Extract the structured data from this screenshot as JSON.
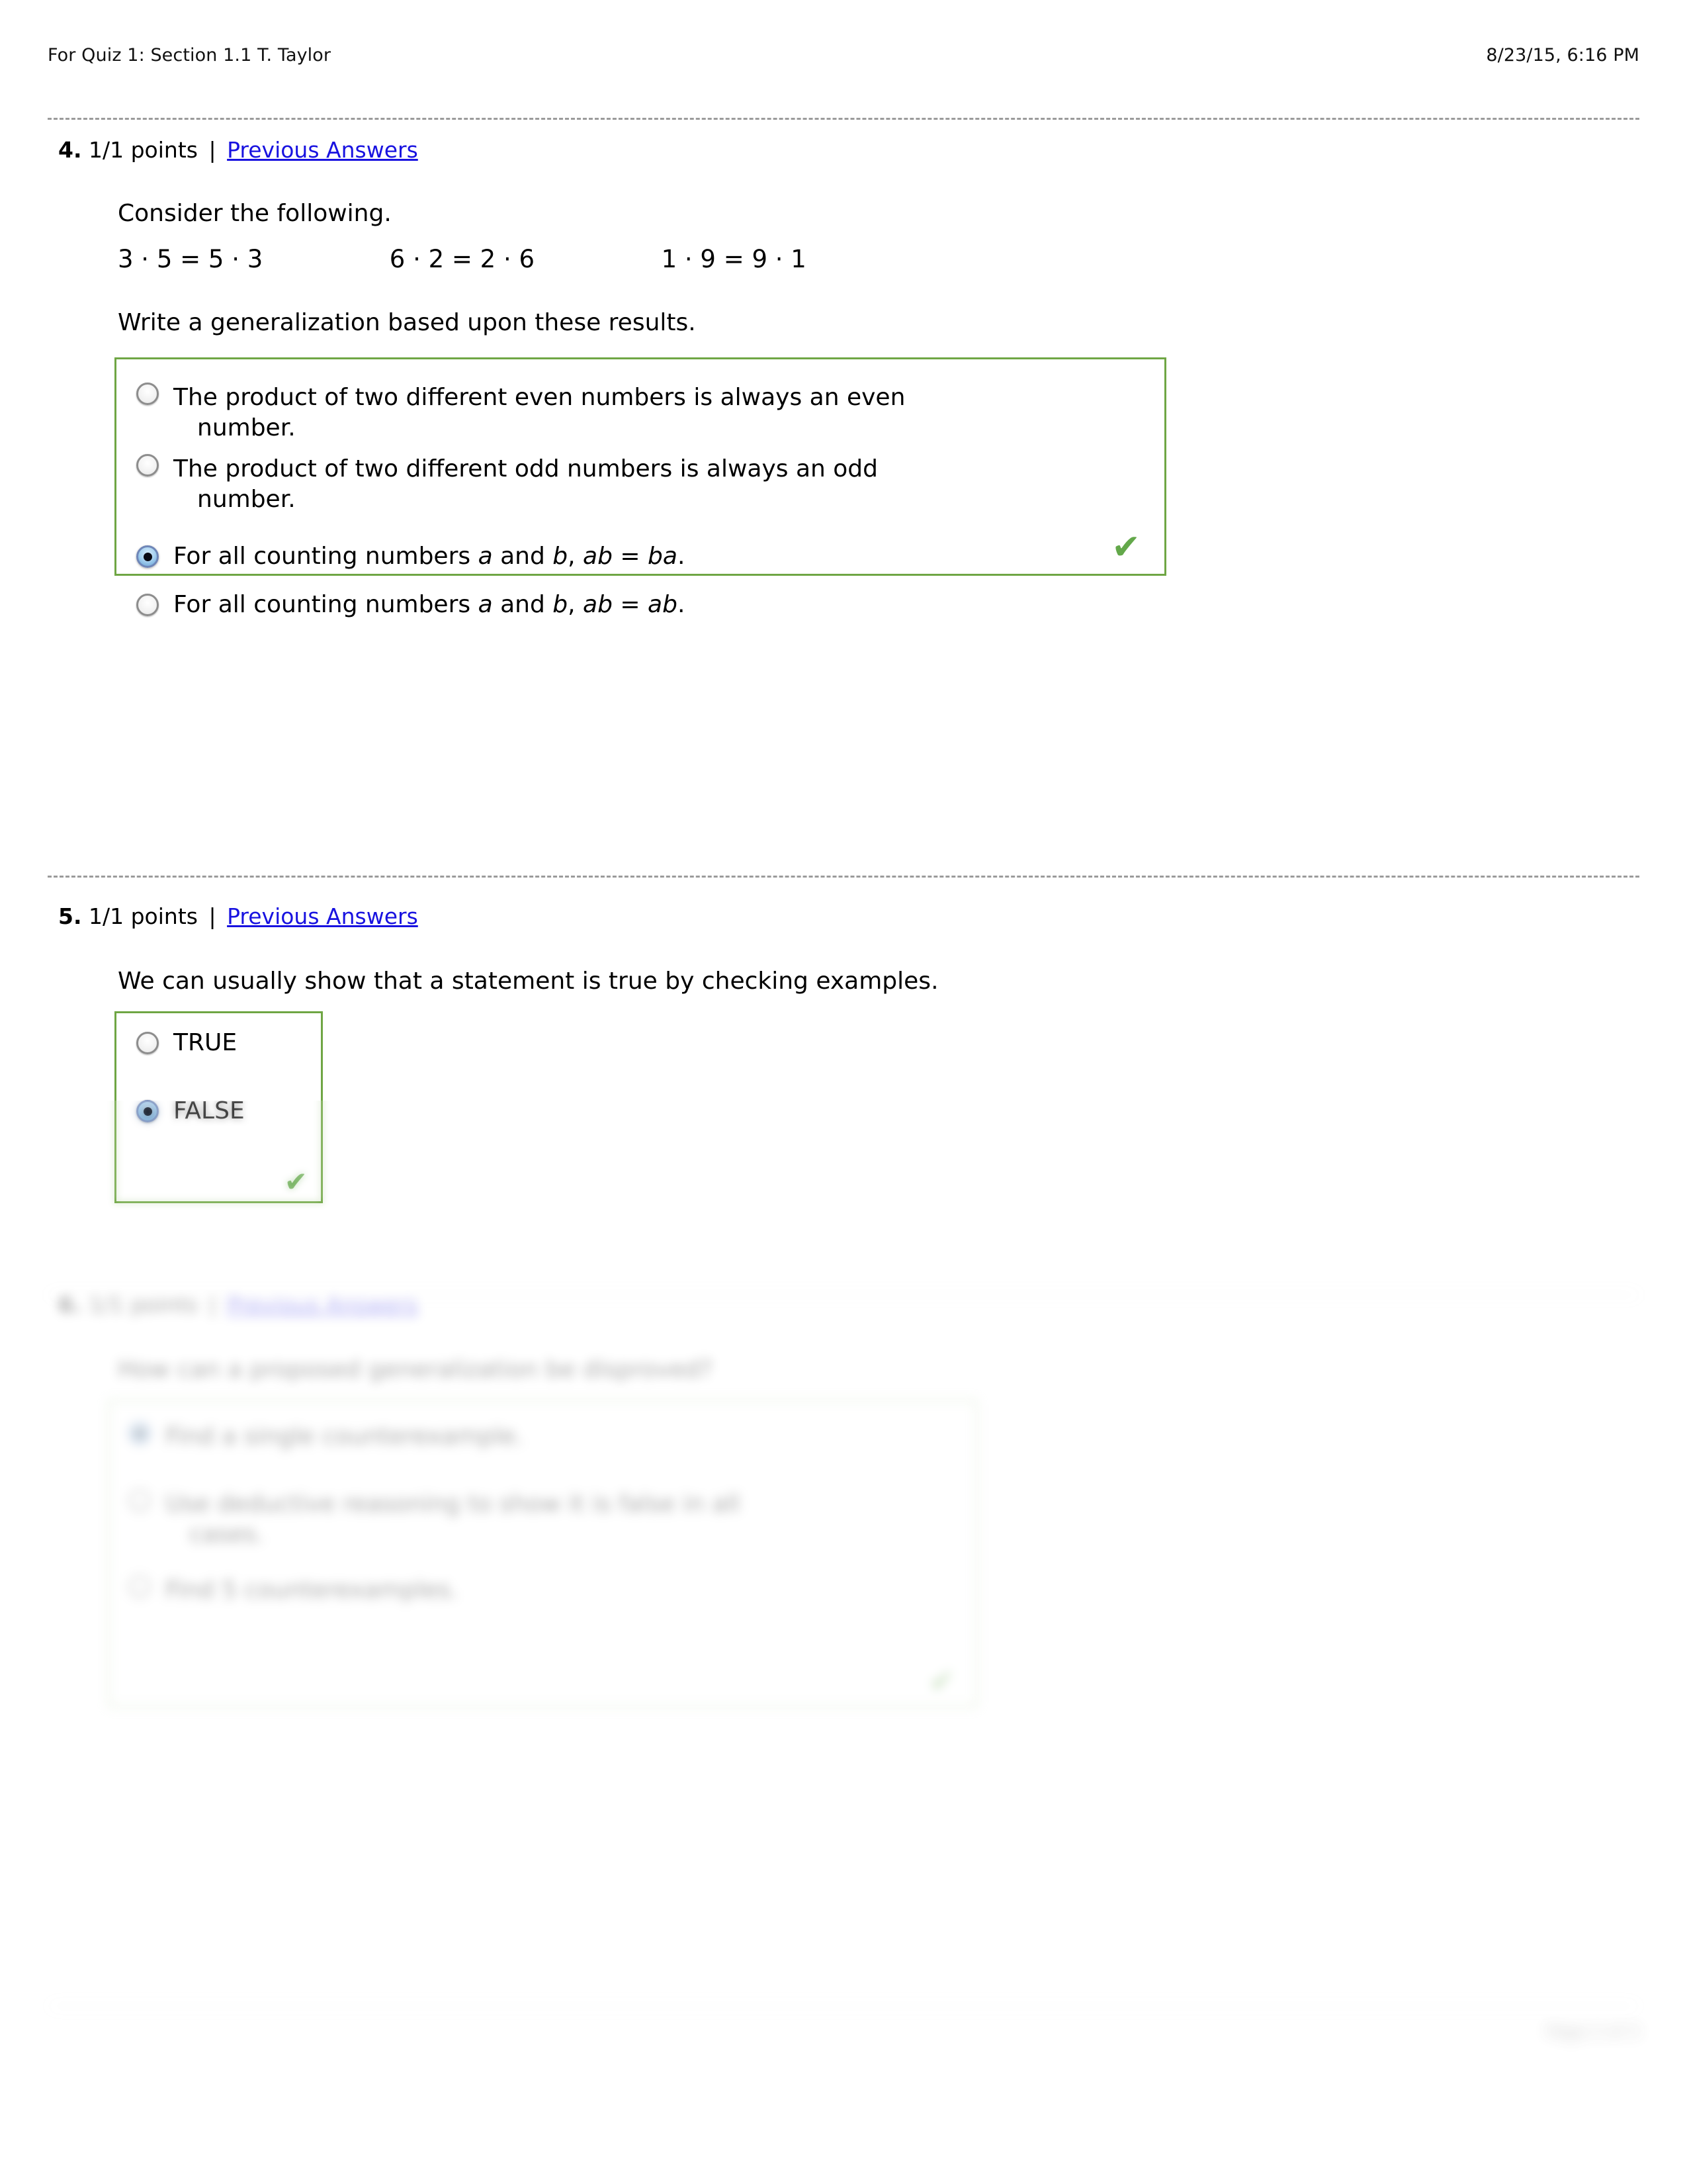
{
  "header": {
    "title": "For Quiz 1: Section 1.1 T. Taylor",
    "timestamp": "8/23/15, 6:16 PM"
  },
  "questions": [
    {
      "number": "4.",
      "points": "1/1 points",
      "separator": "|",
      "previous_answers_label": "Previous Answers",
      "prompt": "Consider the following.",
      "equations": [
        "3 · 5 = 5 · 3",
        "6 · 2 = 2 · 6",
        "1 · 9 = 9 · 1"
      ],
      "instruction": "Write a generalization based upon these results.",
      "options": [
        {
          "line1": "The product of two different even numbers is always an even",
          "line2": "number.",
          "selected": false
        },
        {
          "line1": "The product of two different odd numbers is always an odd",
          "line2": "number.",
          "selected": false
        },
        {
          "pre": "For all counting numbers ",
          "var1": "a",
          "mid": " and ",
          "var2": "b",
          "comma": ", ",
          "expr1": "ab",
          "eq": " = ",
          "expr2": "ba",
          "end": ".",
          "selected": true
        },
        {
          "pre": "For all counting numbers ",
          "var1": "a",
          "mid": " and ",
          "var2": "b",
          "comma": ", ",
          "expr1": "ab",
          "eq": " = ",
          "expr2": "ab",
          "end": ".",
          "selected": false
        }
      ],
      "correct_mark": "✔"
    },
    {
      "number": "5.",
      "points": "1/1 points",
      "separator": "|",
      "previous_answers_label": "Previous Answers",
      "prompt": "We can usually show that a statement is true by checking examples.",
      "options": [
        {
          "label": "TRUE",
          "selected": false
        },
        {
          "label": "FALSE",
          "selected": true
        }
      ],
      "correct_mark": "✔"
    },
    {
      "number": "6.",
      "points": "1/1 points",
      "separator": "|",
      "previous_answers_label": "Previous Answers",
      "prompt": "How can a proposed generalization be disproved?",
      "options": [
        {
          "line1": "Find a single counterexample.",
          "line2": "",
          "selected": true
        },
        {
          "line1": "Use deductive reasoning to show it is false in all",
          "line2": "cases.",
          "selected": false
        },
        {
          "line1": "Find 5 counterexamples.",
          "line2": "",
          "selected": false
        }
      ],
      "correct_mark": "✔"
    }
  ],
  "footer": {
    "left": "",
    "right": "Page 2 of 3"
  },
  "colors": {
    "answer_box_border": "#6fa644",
    "link": "#1812e0",
    "check": "#63a84a",
    "radio_selected": "#a8d2f0"
  }
}
